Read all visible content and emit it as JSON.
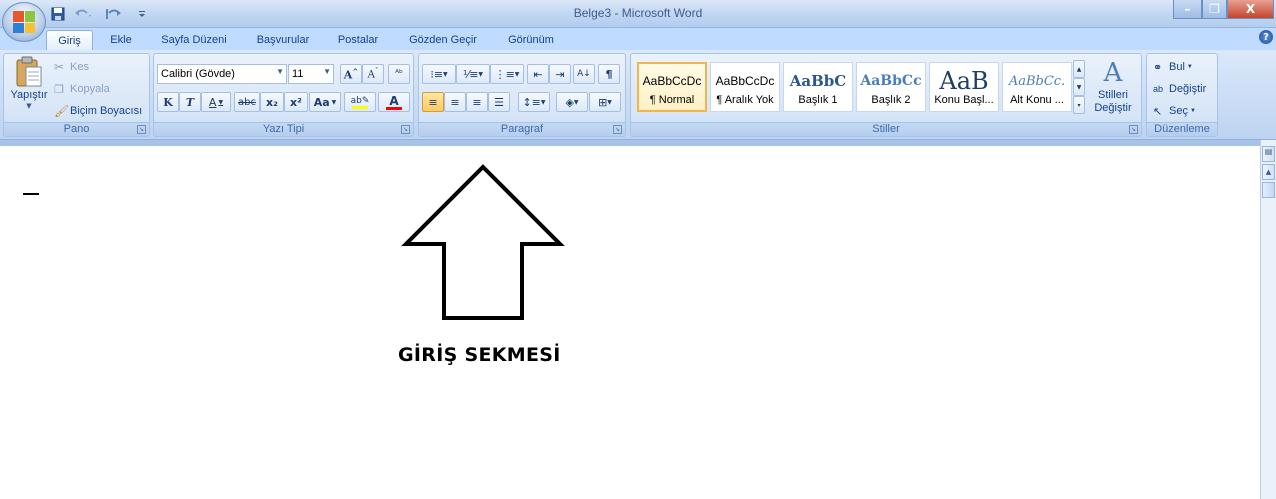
{
  "window": {
    "title": "Belge3 - Microsoft Word",
    "minimize": "–",
    "restore": "❐",
    "close": "X"
  },
  "qat": {
    "save_icon": "save-icon",
    "undo_icon": "undo-icon",
    "redo_icon": "redo-icon",
    "customize_icon": "chevron-down-icon"
  },
  "tabs": [
    {
      "label": "Giriş",
      "active": true
    },
    {
      "label": "Ekle"
    },
    {
      "label": "Sayfa Düzeni"
    },
    {
      "label": "Başvurular"
    },
    {
      "label": "Postalar"
    },
    {
      "label": "Gözden Geçir"
    },
    {
      "label": "Görünüm"
    }
  ],
  "help": "?",
  "groups": {
    "pano": {
      "label": "Pano",
      "paste": "Yapıştır",
      "cut": "Kes",
      "copy": "Kopyala",
      "format_painter": "Biçim Boyacısı"
    },
    "yazi_tipi": {
      "label": "Yazı Tipi",
      "font_name": "Calibri (Gövde)",
      "font_size": "11",
      "bold": "K",
      "italic": "T",
      "underline": "A",
      "strikethrough": "abc",
      "subscript": "x₂",
      "superscript": "x²",
      "change_case": "Aa"
    },
    "paragraf": {
      "label": "Paragraf",
      "pilcrow": "¶"
    },
    "stiller": {
      "label": "Stiller",
      "tiles": [
        {
          "sample": "AaBbCcDc",
          "name": "¶ Normal",
          "selected": true
        },
        {
          "sample": "AaBbCcDc",
          "name": "¶ Aralık Yok"
        },
        {
          "sample": "AaBbC",
          "name": "Başlık 1"
        },
        {
          "sample": "AaBbCc",
          "name": "Başlık 2"
        },
        {
          "sample": "AaB",
          "name": "Konu Başl..."
        },
        {
          "sample": "AaBbCc.",
          "name": "Alt Konu ..."
        }
      ],
      "change_styles_line1": "Stilleri",
      "change_styles_line2": "Değiştir"
    },
    "duzenleme": {
      "label": "Düzenleme",
      "find": "Bul",
      "replace": "Değiştir",
      "select": "Seç"
    }
  },
  "document": {
    "annotation": "GİRİŞ SEKMESİ"
  },
  "colors": {
    "highlight": "#ffff00",
    "font_color": "#ff0000",
    "selected_style": "#f2b44b"
  }
}
